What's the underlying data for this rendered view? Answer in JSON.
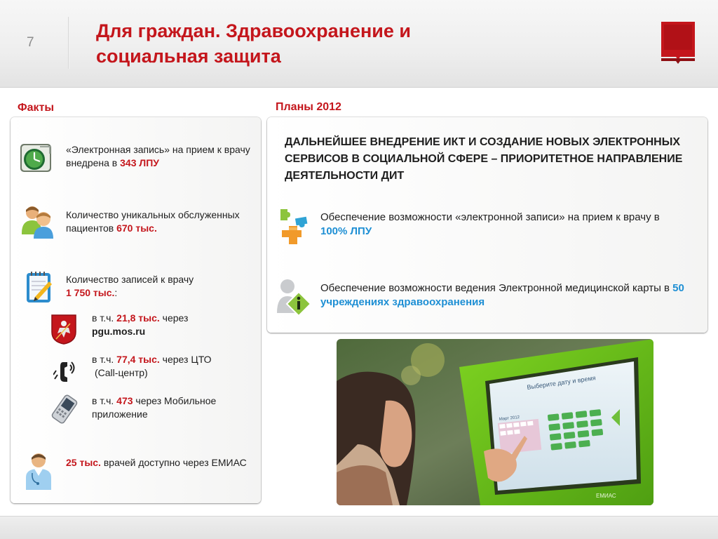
{
  "slide": {
    "number": "7",
    "title_line1": "Для граждан. Здравоохранение и",
    "title_line2": "социальная защита"
  },
  "colors": {
    "accent": "#c4161c",
    "blue_highlight": "#1e8fd4"
  },
  "facts": {
    "label": "Факты",
    "item1": {
      "icon": "clock-icon",
      "text_a": "«Электронная запись» на прием к врачу внедрена в ",
      "value": "343 ЛПУ"
    },
    "item2": {
      "icon": "patients-icon",
      "text_a": "Количество уникальных обслуженных пациентов ",
      "value": "670 тыс."
    },
    "item3": {
      "icon": "notepad-icon",
      "text_a": "Количество записей к врачу",
      "value": "1 750 тыс.",
      "text_b": ":"
    },
    "sub1": {
      "icon": "moscow-coat-of-arms-icon",
      "text_a": "в т.ч. ",
      "value": "21,8 тыс.",
      "text_b": " через",
      "link": "pgu.mos.ru"
    },
    "sub2": {
      "icon": "phone-call-icon",
      "text_a": "в т.ч. ",
      "value": "77,4 тыс.",
      "text_b": " через ЦТО",
      "text_c": "(Call-центр)"
    },
    "sub3": {
      "icon": "mobile-phone-icon",
      "text_a": "в т.ч. ",
      "value": "473",
      "text_b": " через Мобильное приложение"
    },
    "item4": {
      "icon": "doctor-icon",
      "value": "25 тыс.",
      "text_b": " врачей доступно через ЕМИАС"
    }
  },
  "plans": {
    "label": "Планы 2012",
    "heading": "ДАЛЬНЕЙШЕЕ ВНЕДРЕНИЕ ИКТ И СОЗДАНИЕ НОВЫХ ЭЛЕКТРОННЫХ СЕРВИСОВ В СОЦИАЛЬНОЙ СФЕРЕ – ПРИОРИТЕТНОЕ НАПРАВЛЕНИЕ ДЕЯТЕЛЬНОСТИ ДИТ",
    "item1": {
      "icon": "puzzle-pieces-icon",
      "text_a": "Обеспечение возможности «электронной записи» на прием к врачу в ",
      "value": "100% ЛПУ"
    },
    "item2": {
      "icon": "person-info-icon",
      "text_a": "Обеспечение возможности ведения Электронной медицинской карты в ",
      "value": "50 учреждениях здравоохранения"
    }
  },
  "kiosk_photo": {
    "screen_title": "Выберите дату и время",
    "month": "Март 2012",
    "brand": "ЕМИАС"
  }
}
